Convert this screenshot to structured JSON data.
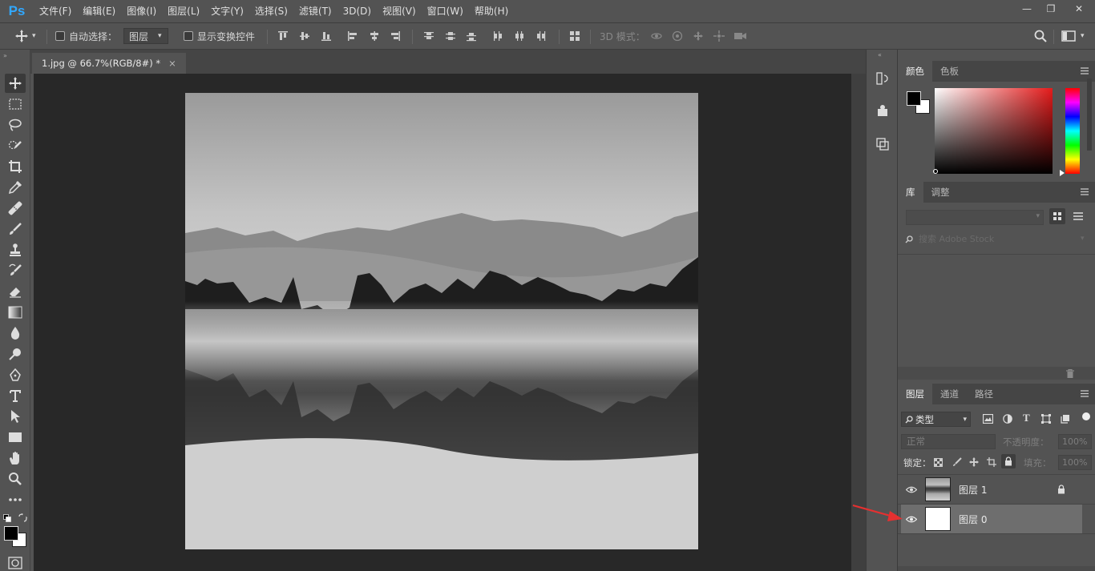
{
  "app": {
    "logo": "Ps"
  },
  "menu": [
    "文件(F)",
    "编辑(E)",
    "图像(I)",
    "图层(L)",
    "文字(Y)",
    "选择(S)",
    "滤镜(T)",
    "3D(D)",
    "视图(V)",
    "窗口(W)",
    "帮助(H)"
  ],
  "window_controls": {
    "minimize": "—",
    "restore": "❐",
    "close": "✕"
  },
  "options_bar": {
    "auto_select_label": "自动选择：",
    "auto_select_target": "图层",
    "show_transform_label": "显示变换控件",
    "mode_3d_label": "3D 模式："
  },
  "document": {
    "tab_title": "1.jpg @ 66.7%(RGB/8#) *",
    "tab_close": "×"
  },
  "color_panel": {
    "tabs": [
      "颜色",
      "色板"
    ],
    "foreground": "#000000",
    "background": "#ffffff"
  },
  "library_panel": {
    "tabs": [
      "库",
      "调整"
    ],
    "search_placeholder": "搜索 Adobe Stock"
  },
  "layers_panel": {
    "tabs": [
      "图层",
      "通道",
      "路径"
    ],
    "filter_label": "类型",
    "blend_mode": "正常",
    "opacity_label": "不透明度：",
    "opacity_value": "100%",
    "lock_label": "锁定：",
    "fill_label": "填充：",
    "fill_value": "100%",
    "layers": [
      {
        "name": "图层 1",
        "visible": true,
        "locked": true,
        "thumb": "photo"
      },
      {
        "name": "图层 0",
        "visible": true,
        "locked": false,
        "thumb": "white"
      }
    ]
  },
  "colors": {
    "accent_blue": "#31a8ff",
    "arrow_red": "#e53030"
  }
}
